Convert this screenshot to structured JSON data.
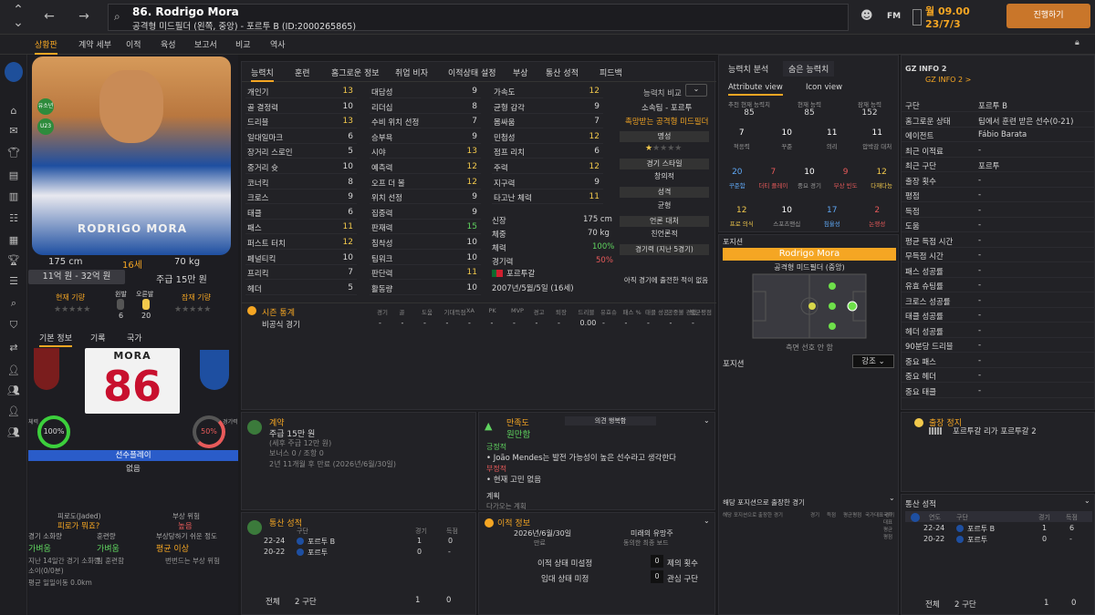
{
  "header": {
    "title": "86. Rodrigo Mora",
    "subtitle": "공격형 미드필더 (왼쪽, 중앙) - 포르투 B (ID:2000265865)",
    "date_line1": "월 09.00",
    "date_line2": "23/7/3",
    "continue_label": "진행하기",
    "fm_label": "FM"
  },
  "subtabs": [
    "상황판",
    "계약 세부",
    "이적",
    "육성",
    "보고서",
    "비교",
    "역사"
  ],
  "profile": {
    "height": "175 cm",
    "age": "16세",
    "weight": "70 kg",
    "value": "11억 원 - 32억 원",
    "wage": "주급 15만 원",
    "badge1": "유소년",
    "badge2": "U23",
    "current_label": "현재 기량",
    "potential_label": "잠재 기량",
    "left_foot": "왼발",
    "left_val": "6",
    "right_foot": "오른발",
    "right_val": "20",
    "shirt_name": "RODRIGO MORA",
    "jersey_name": "MORA",
    "jersey_number": "86"
  },
  "lower_left": {
    "tabs": [
      "기본 정보",
      "기록",
      "국가"
    ],
    "fitness_label": "체력",
    "fitness": "100%",
    "sharp_label": "경기력",
    "sharp": "50%",
    "role_btn": "선수플레이",
    "role_val": "없음",
    "fatigue_label": "피로도(Jaded)",
    "fatigue_val": "피로가 뭐죠?",
    "injury_label": "부상 위험",
    "injury_val": "높음",
    "load_label": "경기 소화량",
    "load_val": "가벼움",
    "train_label": "훈련량",
    "train_val": "가벼움",
    "risk_label": "부상당하기 쉬운 정도",
    "risk_val": "평균 이상",
    "line1": "지난 14일간 경기 소화량",
    "line1b": "팀 훈련함",
    "line1c": "번번드는 부상 위험",
    "line2": "소이(0/0분)",
    "line3": "평균 일일이동 0.0km"
  },
  "attr_tabs": [
    "능력치",
    "훈련",
    "홈그로운 정보",
    "취업 비자",
    "이적상태 설정",
    "부상",
    "통산 성적",
    "피드백"
  ],
  "attrs_col1": [
    [
      "개인기",
      "13"
    ],
    [
      "골 결정력",
      "10"
    ],
    [
      "드리블",
      "13"
    ],
    [
      "일대일마크",
      "6"
    ],
    [
      "장거리 스로인",
      "5"
    ],
    [
      "중거리 슛",
      "10"
    ],
    [
      "코너킥",
      "8"
    ],
    [
      "크로스",
      "9"
    ],
    [
      "태클",
      "6"
    ],
    [
      "패스",
      "11"
    ],
    [
      "퍼스트 터치",
      "12"
    ],
    [
      "페널티킥",
      "10"
    ],
    [
      "프리킥",
      "7"
    ],
    [
      "헤더",
      "5"
    ]
  ],
  "attrs_col2": [
    [
      "대담성",
      "9"
    ],
    [
      "리더십",
      "8"
    ],
    [
      "수비 위치 선정",
      "7"
    ],
    [
      "승부욕",
      "9"
    ],
    [
      "시야",
      "13"
    ],
    [
      "예측력",
      "12"
    ],
    [
      "오프 더 볼",
      "12"
    ],
    [
      "위치 선정",
      "9"
    ],
    [
      "집중력",
      "9"
    ],
    [
      "판재력",
      "15"
    ],
    [
      "침착성",
      "10"
    ],
    [
      "팀워크",
      "10"
    ],
    [
      "판단력",
      "11"
    ],
    [
      "활동량",
      "10"
    ]
  ],
  "attrs_col3": [
    [
      "가속도",
      "12"
    ],
    [
      "균형 감각",
      "9"
    ],
    [
      "몸싸움",
      "7"
    ],
    [
      "민첩성",
      "12"
    ],
    [
      "점프 리치",
      "6"
    ],
    [
      "주력",
      "12"
    ],
    [
      "지구력",
      "9"
    ],
    [
      "타고난 체력",
      "11"
    ]
  ],
  "phys": {
    "height_label": "신장",
    "height": "175 cm",
    "weight_label": "체중",
    "weight": "70 kg",
    "fit_label": "체력",
    "fit": "100%",
    "sharp_label": "경기력",
    "sharp": "50%",
    "nation": "포르투갈",
    "dob": "2007년/5월/5일 (16세)"
  },
  "compare": {
    "title": "능력치 비교",
    "club": "소속팀 - 포르투",
    "role": "촉망받는 공격형 미드필더",
    "rep_label": "명성",
    "style_label": "경기 스타일",
    "style_val": "창의적",
    "pers_label": "성격",
    "pers_val": "균형",
    "media_label": "언론 대처",
    "media_val": "친언론적",
    "form_label": "경기력 (지난 5경기)",
    "form_val": "아직 경기에 출전한 적이 없음"
  },
  "season": {
    "title": "시즌 통계",
    "headers": [
      "경기",
      "골",
      "도움",
      "기대득점",
      "XA",
      "PK",
      "MVP",
      "경고",
      "퇴장",
      "드리블",
      "유효슈",
      "패스 %",
      "태클 성공",
      "공중볼 경합",
      "평균평점"
    ],
    "row_label": "비공식 경기",
    "row": [
      "-",
      "-",
      "-",
      "-",
      "-",
      "-",
      "-",
      "-",
      "-",
      "0.00",
      "-",
      "-",
      "-",
      "-",
      "-"
    ]
  },
  "contract": {
    "title": "계약",
    "wage": "주급 15만 원",
    "detail": "(세후 주급 12만 원)",
    "bonus": "보너스 0 / 조항 0",
    "expiry": "2년 11개월 후 만료 (2026년/6월/30일)"
  },
  "happiness": {
    "title": "만족도",
    "value": "원만함",
    "label": "의견 행복함",
    "positive_label": "긍정적",
    "positive": "João Mendes는 발전 가능성이 높은 선수라고 생각한다",
    "negative_label": "부정적",
    "negative": "현재 고민 없음",
    "plans_label": "계획",
    "plans": "다가오는 계획"
  },
  "career": {
    "title": "통산 성적",
    "headers": [
      "구단",
      "경기",
      "득점"
    ],
    "rows": [
      [
        "22-24",
        "포르투 B",
        "1",
        "0"
      ],
      [
        "20-22",
        "포르투",
        "0",
        "-"
      ]
    ],
    "total_label": "전체",
    "total_clubs": "2 구단",
    "total_apps": "1",
    "total_goals": "0"
  },
  "transfer": {
    "title": "이적 정보",
    "date": "2026년/6월/30일",
    "date_label": "만료",
    "future": "미래의 유망주",
    "future_label": "동의한 최종 보드",
    "status1": "이적 상태 미설정",
    "status2": "임대 상태 미정",
    "offers": "0",
    "offers_label": "제의 횟수",
    "interest": "0",
    "interest_label": "관심 구단"
  },
  "analysis": {
    "tabs": [
      "능력치 분석",
      "숨은 능력치"
    ],
    "views": [
      "Attribute view",
      "Icon view"
    ],
    "top": [
      [
        "추천 현재 능력치",
        "85"
      ],
      [
        "현재 능력",
        "85"
      ],
      [
        "잠재 능력",
        "152"
      ]
    ],
    "row1": [
      [
        "7",
        "적응력"
      ],
      [
        "10",
        "꾸준"
      ],
      [
        "11",
        "의리"
      ],
      [
        "11",
        "압박감 대처"
      ]
    ],
    "row2": [
      [
        "20",
        "꾸준함"
      ],
      [
        "7",
        "더티 플레이"
      ],
      [
        "10",
        "중요 경기"
      ],
      [
        "9",
        "부상 빈도"
      ],
      [
        "12",
        "다재다능"
      ]
    ],
    "row3": [
      [
        "12",
        "프로 의식"
      ],
      [
        "10",
        "스포츠맨십"
      ],
      [
        "17",
        "침울성"
      ],
      [
        "2",
        "논쟁성"
      ]
    ]
  },
  "position": {
    "title": "포지션",
    "name": "Rodrigo Mora",
    "role": "공격형 미드필더 (중앙)",
    "note": "측면 선호 안 함",
    "pos_label": "포지션",
    "dropdown": "강조",
    "matches_title": "해당 포지션으로 출장한 경기",
    "match_headers": [
      "해당 포지션으로 출장한 경기",
      "경기",
      "득점",
      "평균평점",
      "국가대표 경기",
      "국가대표 평균평점"
    ]
  },
  "gzinfo": {
    "title": "GZ INFO 2",
    "link": "GZ INFO 2 >",
    "rows": [
      [
        "구단",
        "포르투 B"
      ],
      [
        "홈그로운 상태",
        "팀에서 훈련 받은 선수(0-21)"
      ],
      [
        "에이전트",
        "Fábio Barata"
      ],
      [
        "최근 이적료",
        "-"
      ],
      [
        "최근 구단",
        "포르투"
      ],
      [
        "출장 횟수",
        "-"
      ],
      [
        "평점",
        "-"
      ],
      [
        "득점",
        "-"
      ],
      [
        "도움",
        "-"
      ],
      [
        "평균 득점 시간",
        "-"
      ],
      [
        "무득점 시간",
        "-"
      ],
      [
        "패스 성공률",
        "-"
      ],
      [
        "유효 슈팅률",
        "-"
      ],
      [
        "크로스 성공률",
        "-"
      ],
      [
        "태클 성공률",
        "-"
      ],
      [
        "헤더 성공률",
        "-"
      ],
      [
        "90분당 드리블",
        "-"
      ],
      [
        "중요 패스",
        "-"
      ],
      [
        "중요 헤더",
        "-"
      ],
      [
        "중요 태클",
        "-"
      ]
    ],
    "loan_title": "출장 정지",
    "loan_text": "포르투갈 리가 포르투갈 2"
  },
  "right_career": {
    "title": "통산 성적",
    "headers": [
      "연도",
      "구단",
      "경기",
      "득점"
    ],
    "rows": [
      [
        "22-24",
        "포르투 B",
        "1",
        "6"
      ],
      [
        "20-22",
        "포르투",
        "0",
        "-"
      ]
    ],
    "total_label": "전체",
    "total_clubs": "2 구단",
    "total_apps": "1",
    "total_goals": "0"
  },
  "colors": {
    "accent": "#f5a623",
    "green": "#5fd35f",
    "yellow": "#f2c94c",
    "red": "#e85a5a",
    "continue": "#c9762a"
  }
}
